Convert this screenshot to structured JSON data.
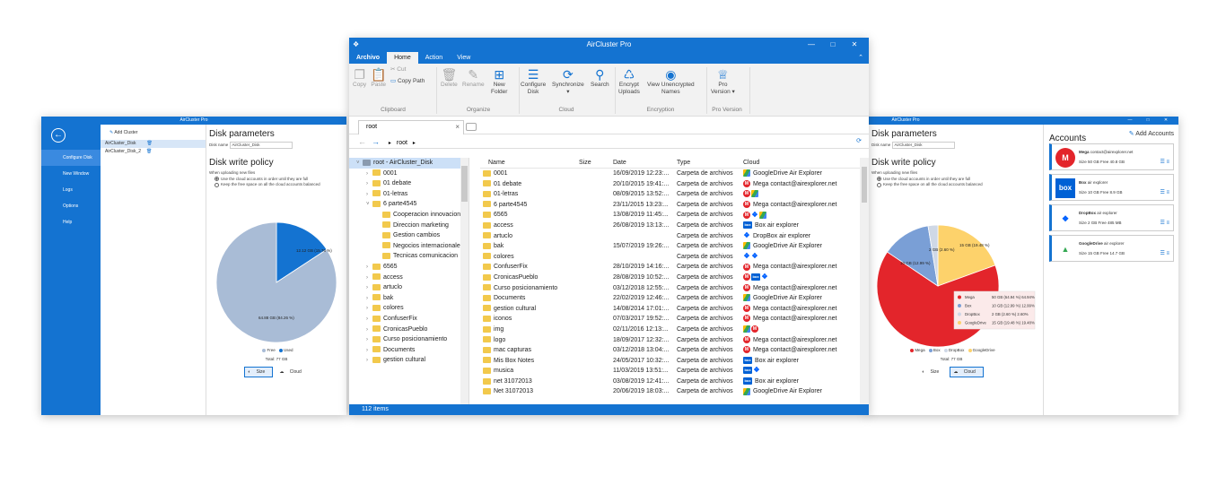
{
  "colors": {
    "accent": "#1473d1",
    "mega": "#e3252b",
    "free": "#a9bcd6",
    "used": "#1473d1",
    "box": "#7a9fd6",
    "dropbox": "#cfd8e6",
    "gdrive": "#fdd26b"
  },
  "left_window": {
    "title": "AirCluster Pro",
    "sidebar": [
      "Configure Disk",
      "New Window",
      "Logs",
      "Options",
      "Help"
    ],
    "add_cluster": "Add Cluster",
    "disks": [
      "AirCluster_Disk",
      "AirCluster_Disk_2"
    ],
    "heading": "Disk parameters",
    "disk_name_label": "Disk name",
    "disk_name_value": "AirCluster_Disk",
    "policy_heading": "Disk write policy",
    "policy_note": "When uploading new files",
    "policy_opt1": "Use the cloud accounts in order until they are full",
    "policy_opt2": "Keep the free space on all the cloud accounts balanced",
    "pie_used_label": "12.12 GB (15.76 %)",
    "pie_free_label": "64.88 GB (84.26 %)",
    "legend_free": "Free",
    "legend_used": "Used",
    "total": "Total: 77 GB",
    "toggle_size": "Size",
    "toggle_cloud": "Cloud",
    "values": {
      "free_pct": 84.26,
      "used_pct": 15.76
    }
  },
  "center_window": {
    "title": "AirCluster Pro",
    "tabs": [
      "Archivo",
      "Home",
      "Action",
      "View"
    ],
    "ribbon": {
      "copy": "Copy",
      "paste": "Paste",
      "cut": "Cut",
      "copy_path": "Copy Path",
      "delete": "Delete",
      "rename": "Rename",
      "new_folder": "New\nFolder",
      "configure": "Configure\nDisk",
      "synchronize": "Synchronize",
      "search": "Search",
      "encrypt": "Encrypt\nUploads",
      "view_unencrypted": "View Unencrypted\nNames",
      "pro": "Pro\nVersion",
      "groups": [
        "Clipboard",
        "Organize",
        "Cloud",
        "Encryption",
        "Pro Version"
      ]
    },
    "doc_tab": "root",
    "address": "root",
    "tree": [
      {
        "label": "root - AirCluster_Disk",
        "level": 0,
        "open": true,
        "sel": true
      },
      {
        "label": "0001",
        "level": 1
      },
      {
        "label": "01 debate",
        "level": 1
      },
      {
        "label": "01-letras",
        "level": 1
      },
      {
        "label": "6 parte4545",
        "level": 1,
        "open": true
      },
      {
        "label": "Cooperacion innovacion",
        "level": 2
      },
      {
        "label": "Direccion marketing",
        "level": 2
      },
      {
        "label": "Gestion cambios",
        "level": 2
      },
      {
        "label": "Negocios internacionales",
        "level": 2
      },
      {
        "label": "Tecnicas comunicacion",
        "level": 2
      },
      {
        "label": "6565",
        "level": 1
      },
      {
        "label": "access",
        "level": 1
      },
      {
        "label": "artuclo",
        "level": 1
      },
      {
        "label": "bak",
        "level": 1
      },
      {
        "label": "colores",
        "level": 1
      },
      {
        "label": "ConfuserFix",
        "level": 1
      },
      {
        "label": "CronicasPueblo",
        "level": 1
      },
      {
        "label": "Curso posicionamiento",
        "level": 1
      },
      {
        "label": "Documents",
        "level": 1
      },
      {
        "label": "gestion cultural",
        "level": 1
      }
    ],
    "columns": {
      "name": "Name",
      "size": "Size",
      "date": "Date",
      "type": "Type",
      "cloud": "Cloud"
    },
    "files": [
      {
        "name": "0001",
        "date": "16/09/2019 12:23:...",
        "type": "Carpeta de archivos",
        "icons": [
          "g"
        ],
        "cloud": "GoogleDrive Air Explorer"
      },
      {
        "name": "01 debate",
        "date": "20/10/2015 19:41:...",
        "type": "Carpeta de archivos",
        "icons": [
          "m"
        ],
        "cloud": "Mega contact@airexplorer.net"
      },
      {
        "name": "01-letras",
        "date": "08/09/2015 13:52:...",
        "type": "Carpeta de archivos",
        "icons": [
          "m",
          "g"
        ],
        "cloud": ""
      },
      {
        "name": "6 parte4545",
        "date": "23/11/2015 13:23:...",
        "type": "Carpeta de archivos",
        "icons": [
          "m"
        ],
        "cloud": "Mega contact@airexplorer.net"
      },
      {
        "name": "6565",
        "date": "13/08/2019 11:45:...",
        "type": "Carpeta de archivos",
        "icons": [
          "m",
          "d",
          "g"
        ],
        "cloud": ""
      },
      {
        "name": "access",
        "date": "26/08/2019 13:13:...",
        "type": "Carpeta de archivos",
        "icons": [
          "b"
        ],
        "cloud": "Box air explorer"
      },
      {
        "name": "artuclo",
        "date": "",
        "type": "Carpeta de archivos",
        "icons": [
          "d"
        ],
        "cloud": "DropBox air explorer"
      },
      {
        "name": "bak",
        "date": "15/07/2019 19:26:...",
        "type": "Carpeta de archivos",
        "icons": [
          "g"
        ],
        "cloud": "GoogleDrive Air Explorer"
      },
      {
        "name": "colores",
        "date": "",
        "type": "Carpeta de archivos",
        "icons": [
          "d",
          "d"
        ],
        "cloud": ""
      },
      {
        "name": "ConfuserFix",
        "date": "28/10/2019 14:16:...",
        "type": "Carpeta de archivos",
        "icons": [
          "m"
        ],
        "cloud": "Mega contact@airexplorer.net"
      },
      {
        "name": "CronicasPueblo",
        "date": "28/08/2019 10:52:...",
        "type": "Carpeta de archivos",
        "icons": [
          "m",
          "b",
          "d"
        ],
        "cloud": ""
      },
      {
        "name": "Curso posicionamiento",
        "date": "03/12/2018 12:55:...",
        "type": "Carpeta de archivos",
        "icons": [
          "m"
        ],
        "cloud": "Mega contact@airexplorer.net"
      },
      {
        "name": "Documents",
        "date": "22/02/2019 12:46:...",
        "type": "Carpeta de archivos",
        "icons": [
          "g"
        ],
        "cloud": "GoogleDrive Air Explorer"
      },
      {
        "name": "gestion cultural",
        "date": "14/08/2014 17:01:...",
        "type": "Carpeta de archivos",
        "icons": [
          "m"
        ],
        "cloud": "Mega contact@airexplorer.net"
      },
      {
        "name": "iconos",
        "date": "07/03/2017 19:52:...",
        "type": "Carpeta de archivos",
        "icons": [
          "m"
        ],
        "cloud": "Mega contact@airexplorer.net"
      },
      {
        "name": "img",
        "date": "02/11/2016 12:13:...",
        "type": "Carpeta de archivos",
        "icons": [
          "g",
          "m"
        ],
        "cloud": ""
      },
      {
        "name": "logo",
        "date": "18/09/2017 12:32:...",
        "type": "Carpeta de archivos",
        "icons": [
          "m"
        ],
        "cloud": "Mega contact@airexplorer.net"
      },
      {
        "name": "mac capturas",
        "date": "03/12/2018 13:04:...",
        "type": "Carpeta de archivos",
        "icons": [
          "m"
        ],
        "cloud": "Mega contact@airexplorer.net"
      },
      {
        "name": "Mis Box Notes",
        "date": "24/05/2017 10:32:...",
        "type": "Carpeta de archivos",
        "icons": [
          "b"
        ],
        "cloud": "Box air explorer"
      },
      {
        "name": "musica",
        "date": "11/03/2019 13:51:...",
        "type": "Carpeta de archivos",
        "icons": [
          "b",
          "d"
        ],
        "cloud": ""
      },
      {
        "name": "net 31072013",
        "date": "03/08/2019 12:41:...",
        "type": "Carpeta de archivos",
        "icons": [
          "b"
        ],
        "cloud": "Box air explorer"
      },
      {
        "name": "Net 31072013",
        "date": "20/06/2019 18:03:...",
        "type": "Carpeta de archivos",
        "icons": [
          "g"
        ],
        "cloud": "GoogleDrive Air Explorer"
      }
    ],
    "status": "112 items"
  },
  "right_window": {
    "title": "AirCluster Pro",
    "heading": "Disk parameters",
    "disk_name_label": "Disk name",
    "disk_name_value": "AirCluster_Disk",
    "policy_heading": "Disk write policy",
    "policy_note": "When uploading new files",
    "policy_opt1": "Use the cloud accounts in order until they are full",
    "policy_opt2": "Keep the free space on all the cloud accounts balanced",
    "pie_box_label": "10 GB (12.99 %)",
    "pie_dropbox_label": "2 GB (2.60 %)",
    "pie_gdrive_label": "15 GB (19.48 %)",
    "tooltip": [
      {
        "name": "Mega",
        "val": "50 GB (64.94 %) 64.94%"
      },
      {
        "name": "Box",
        "val": "10 GB (12.99 %) 12.99%"
      },
      {
        "name": "DropBox",
        "val": "2 GB (2.60 %) 2.60%"
      },
      {
        "name": "GoogleDrive",
        "val": "15 GB (19.48 %) 19.48%"
      }
    ],
    "legend": [
      "Mega",
      "Box",
      "DropBox",
      "GoogleDrive"
    ],
    "total": "Total: 77 GB",
    "toggle_size": "Size",
    "toggle_cloud": "Cloud",
    "accounts_heading": "Accounts",
    "add_accounts": "Add Accounts",
    "accounts": [
      {
        "logo": "M",
        "name": "Mega",
        "user": "contact@airexplorer.net",
        "size": "Size 50 GB  Free 40.8 GB",
        "color": "#e3252b"
      },
      {
        "logo": "box",
        "name": "Box",
        "user": "air explorer",
        "size": "Size 10 GB  Free 8.9 GB",
        "color": "#0061d5"
      },
      {
        "logo": "❖",
        "name": "DropBox",
        "user": "air explorer",
        "size": "Size 2 GB  Free 485 MB",
        "color": "#0061fe"
      },
      {
        "logo": "▲",
        "name": "GoogleDrive",
        "user": "air explorer",
        "size": "Size 15 GB  Free 14.7 GB",
        "color": "#34a853"
      }
    ],
    "values": {
      "mega_pct": 64.94,
      "box_pct": 12.99,
      "dropbox_pct": 2.6,
      "gdrive_pct": 19.48
    }
  }
}
